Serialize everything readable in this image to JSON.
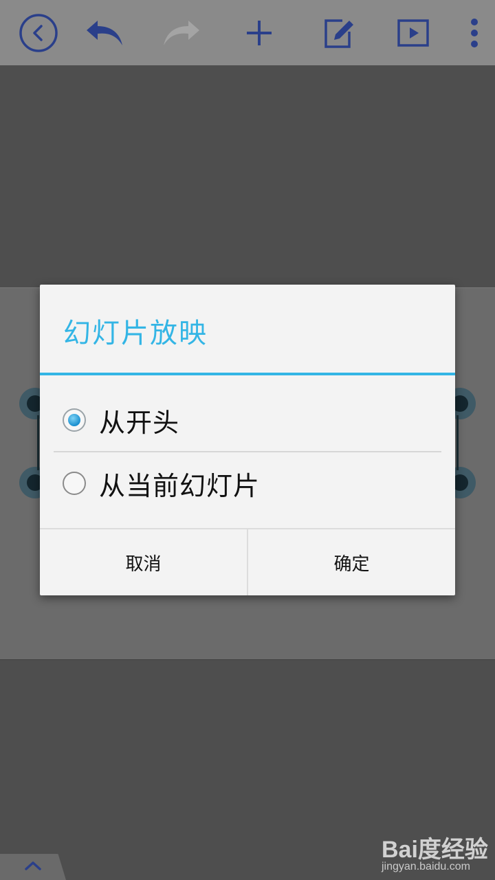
{
  "toolbar": {
    "icons": [
      "back-circle-icon",
      "undo-icon",
      "redo-icon",
      "add-icon",
      "edit-icon",
      "play-icon",
      "more-vert-icon"
    ],
    "accent": "#2a3f8a"
  },
  "dialog": {
    "title": "幻灯片放映",
    "options": [
      {
        "label": "从开头",
        "checked": true
      },
      {
        "label": "从当前幻灯片",
        "checked": false
      }
    ],
    "cancel_label": "取消",
    "ok_label": "确定",
    "accent": "#33b5e5"
  },
  "watermark": {
    "logo": "Bai度经验",
    "url": "jingyan.baidu.com"
  }
}
